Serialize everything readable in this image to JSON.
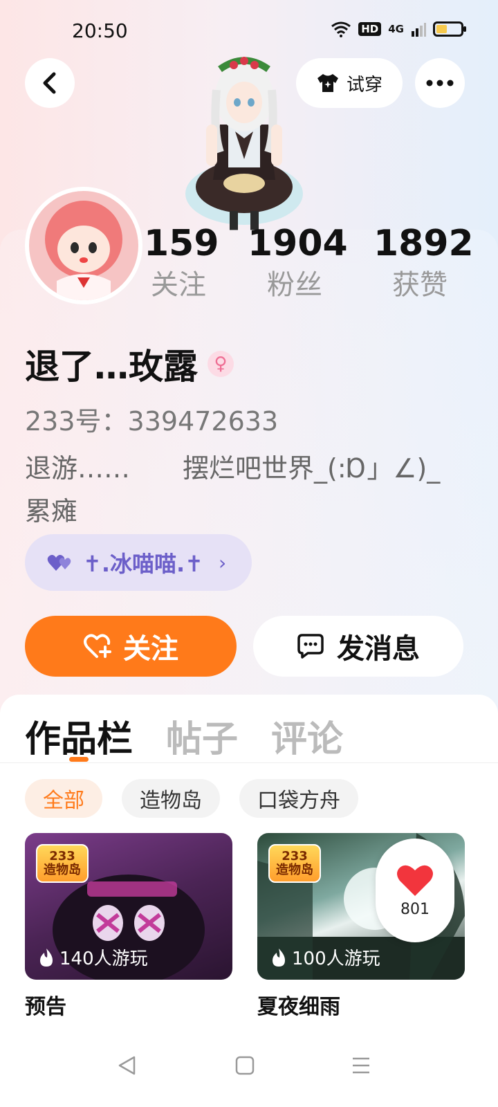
{
  "status_bar": {
    "time": "20:50",
    "hd": "HD",
    "network": "4G",
    "battery_percent": 45
  },
  "header": {
    "tryon_label": "试穿"
  },
  "stats": [
    {
      "value": "159",
      "label": "关注"
    },
    {
      "value": "1904",
      "label": "粉丝"
    },
    {
      "value": "1892",
      "label": "获赞"
    }
  ],
  "profile": {
    "name": "退了…玫露",
    "gender_symbol": "♀",
    "uid": "233号：339472633",
    "bio_line1": "退游……　　摆烂吧世界_(:Ɒ」∠)_",
    "bio_line2": "累瘫",
    "group": "✝.冰喵喵.✝"
  },
  "actions": {
    "follow": "关注",
    "message": "发消息"
  },
  "tabs": [
    "作品栏",
    "帖子",
    "评论"
  ],
  "filters": [
    "全部",
    "造物岛",
    "口袋方舟"
  ],
  "works": [
    {
      "badge_top": "233",
      "badge_bottom": "造物岛",
      "plays": "140人游玩",
      "title": "预告"
    },
    {
      "badge_top": "233",
      "badge_bottom": "造物岛",
      "plays": "100人游玩",
      "title": "夏夜细雨"
    }
  ],
  "like_bubble": {
    "count": "801"
  },
  "colors": {
    "accent": "#ff7a1a",
    "group_purple": "#6c5fc9"
  }
}
